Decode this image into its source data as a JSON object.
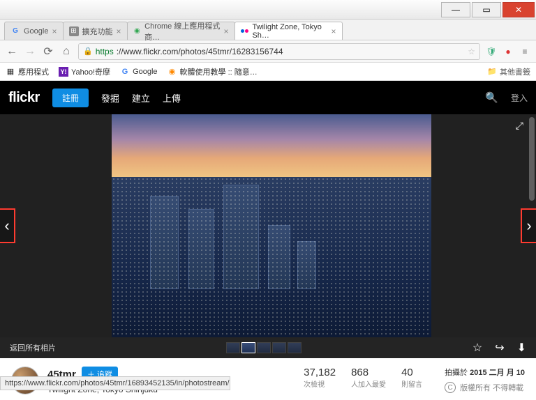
{
  "window": {
    "min_tip": "—",
    "max_tip": "▭",
    "close_tip": "✕"
  },
  "tabs": [
    {
      "label": "Google",
      "favicon": "g",
      "active": false
    },
    {
      "label": "擴充功能",
      "favicon": "ext",
      "active": false
    },
    {
      "label": "Chrome 線上應用程式商…",
      "favicon": "chrome",
      "active": false
    },
    {
      "label": "Twilight Zone, Tokyo Sh…",
      "favicon": "flickr",
      "active": true
    }
  ],
  "addr": {
    "back": "←",
    "fwd": "→",
    "reload": "⟳",
    "home": "⌂",
    "scheme": "https",
    "host_path": "://www.flickr.com/photos/45tmr/16283156744",
    "star": "☆",
    "ext_shield": "🛡",
    "ext_red": "●",
    "menu": "≡"
  },
  "bookmarks": {
    "items": [
      {
        "icon": "📁",
        "label": "應用程式"
      },
      {
        "icon": "Y",
        "label": "Yahoo!奇摩",
        "bg": "#6a1fb1"
      },
      {
        "icon": "G",
        "label": "Google",
        "bg": "#4285f4"
      },
      {
        "icon": "●",
        "label": "軟體使用教學 :: 隨意…"
      }
    ],
    "other": "其他書籤"
  },
  "header": {
    "logo_text": "flick",
    "signup": "註冊",
    "links": [
      "發掘",
      "建立",
      "上傳"
    ],
    "login": "登入"
  },
  "stage": {
    "back_to_photos": "返回所有相片"
  },
  "meta": {
    "owner": "45tmr",
    "follow": "＋ 追蹤",
    "title": "Twilight Zone, Tokyo Shinjuku",
    "stats": [
      {
        "num": "37,182",
        "lbl": "次檢視"
      },
      {
        "num": "868",
        "lbl": "人加入最愛"
      },
      {
        "num": "40",
        "lbl": "則留言"
      }
    ],
    "taken_prefix": "拍攝於 ",
    "taken_date": "2015 二月 月 10",
    "rights_label": "版權所有 不得轉載"
  },
  "status_url": "https://www.flickr.com/photos/45tmr/16893452135/in/photostream/"
}
